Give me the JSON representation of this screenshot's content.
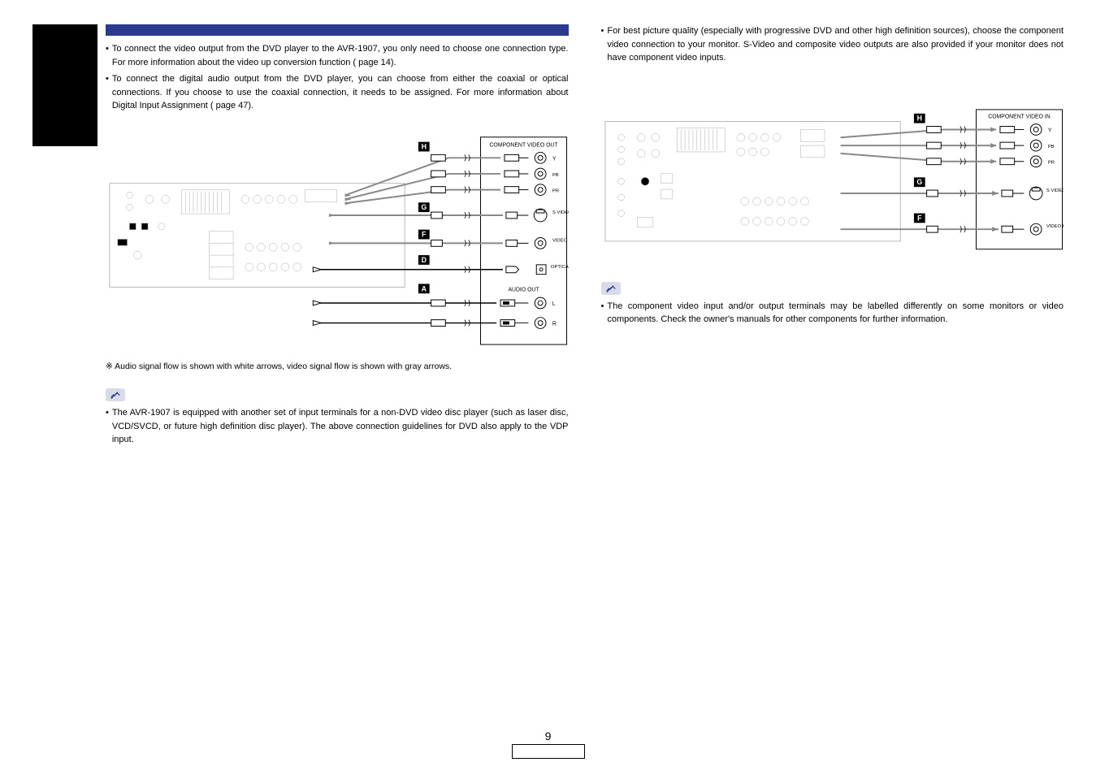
{
  "left": {
    "bullets": [
      "To connect the video output from the DVD player to the AVR-1907, you only need to choose one connection type. For more information about the video up conversion function ( page 14).",
      "To connect the digital audio output from the DVD player, you can choose from either the coaxial or optical connections. If you choose to use the coaxial connection, it needs to be assigned. For more information about Digital Input Assignment ( page 47)."
    ],
    "footnote": "Audio signal flow is shown with white arrows, video signal flow is shown with gray arrows.",
    "note": "The AVR-1907 is equipped with another set of input terminals for a non-DVD video disc player (such as laser disc, VCD/SVCD, or future high definition disc player). The above connection guidelines for DVD also apply to the VDP input."
  },
  "right": {
    "bullets": [
      "For best picture quality (especially with progressive DVD and other high definition sources), choose the component video connection to your monitor. S-Video and composite video outputs are also provided if your monitor does not have component video inputs."
    ],
    "note": "The component video input and/or output terminals may be labelled differently on some monitors or video components. Check the owner's manuals for other components for further information."
  },
  "diagram_left": {
    "badges": [
      "H",
      "G",
      "F",
      "D",
      "A"
    ],
    "panel_title": "COMPONENT VIDEO OUT",
    "labels_ypbpr": [
      "Y",
      "PB",
      "PR"
    ],
    "svideo": "S VIDEO OUT",
    "video": "VIDEO OUT",
    "optical": "OPTICAL OUT",
    "audio_out": "AUDIO OUT",
    "audio_lr": [
      "L",
      "R"
    ]
  },
  "diagram_right": {
    "badges": [
      "H",
      "G",
      "F"
    ],
    "panel_title": "COMPONENT VIDEO IN",
    "labels_ypbpr": [
      "Y",
      "PB",
      "PR"
    ],
    "svideo": "S VIDEO IN",
    "video": "VIDEO IN"
  },
  "page_number": "9"
}
